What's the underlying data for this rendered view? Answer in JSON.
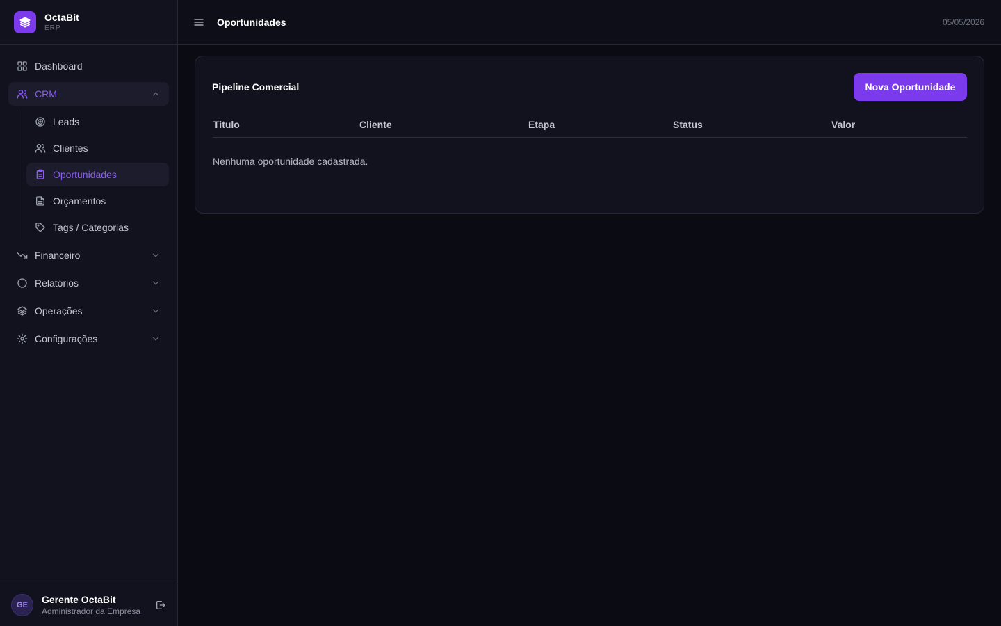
{
  "brand": {
    "name": "OctaBit",
    "sub": "ERP"
  },
  "sidebar": {
    "items": [
      {
        "label": "Dashboard"
      },
      {
        "label": "CRM",
        "expanded": true,
        "children": [
          {
            "label": "Leads"
          },
          {
            "label": "Clientes"
          },
          {
            "label": "Oportunidades",
            "active": true
          },
          {
            "label": "Orçamentos"
          },
          {
            "label": "Tags / Categorias"
          }
        ]
      },
      {
        "label": "Financeiro"
      },
      {
        "label": "Relatórios"
      },
      {
        "label": "Operações"
      },
      {
        "label": "Configurações"
      }
    ]
  },
  "user": {
    "initials": "GE",
    "name": "Gerente OctaBit",
    "role": "Administrador da Empresa"
  },
  "header": {
    "title": "Oportunidades",
    "date": "05/05/2026"
  },
  "main": {
    "card_title": "Pipeline Comercial",
    "new_button": "Nova Oportunidade",
    "columns": [
      "Titulo",
      "Cliente",
      "Etapa",
      "Status",
      "Valor"
    ],
    "empty_message": "Nenhuma oportunidade cadastrada."
  },
  "colors": {
    "accent": "#7c3aed",
    "accent_text": "#8b5cf6",
    "background": "#0b0b14",
    "panel": "#12121e"
  }
}
